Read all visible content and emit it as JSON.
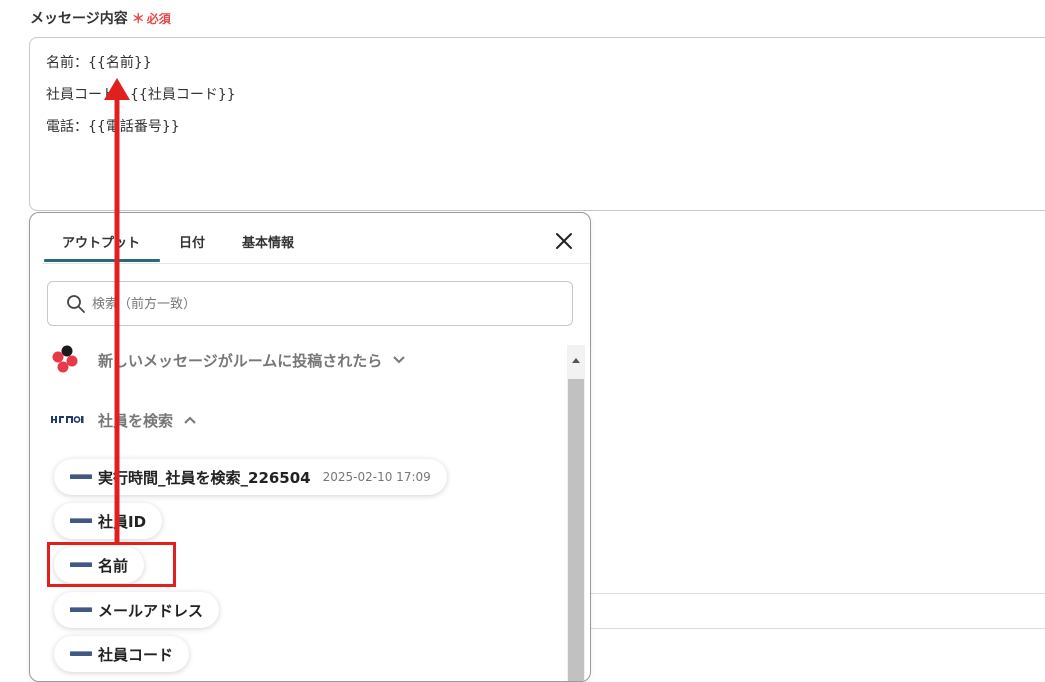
{
  "field": {
    "label": "メッセージ内容",
    "required_star": "＊",
    "required_text": "必須"
  },
  "message": {
    "lines": [
      "名前：{{名前}}",
      "社員コード：{{社員コード}}",
      "電話：{{電話番号}}"
    ]
  },
  "popup": {
    "tabs": [
      "アウトプット",
      "日付",
      "基本情報"
    ],
    "active_tab": "アウトプット",
    "search_placeholder": "検索（前方一致）",
    "sections": [
      {
        "title": "新しいメッセージがルームに投稿されたら",
        "expanded": false,
        "icon": "chatwork-logo"
      },
      {
        "title": "社員を検索",
        "expanded": true,
        "icon": "hrmos-logo"
      }
    ],
    "items": [
      {
        "label": "実行時間_社員を検索_226504",
        "date": "2025-02-10 17:09"
      },
      {
        "label": "社員ID"
      },
      {
        "label": "名前",
        "highlighted": true
      },
      {
        "label": "メールアドレス"
      },
      {
        "label": "社員コード"
      }
    ]
  },
  "colors": {
    "accent_tab": "#2a6a7e",
    "required": "#e5484d",
    "annotation_red": "#e0201f",
    "hrmos_logo": "#1f3b6e"
  }
}
